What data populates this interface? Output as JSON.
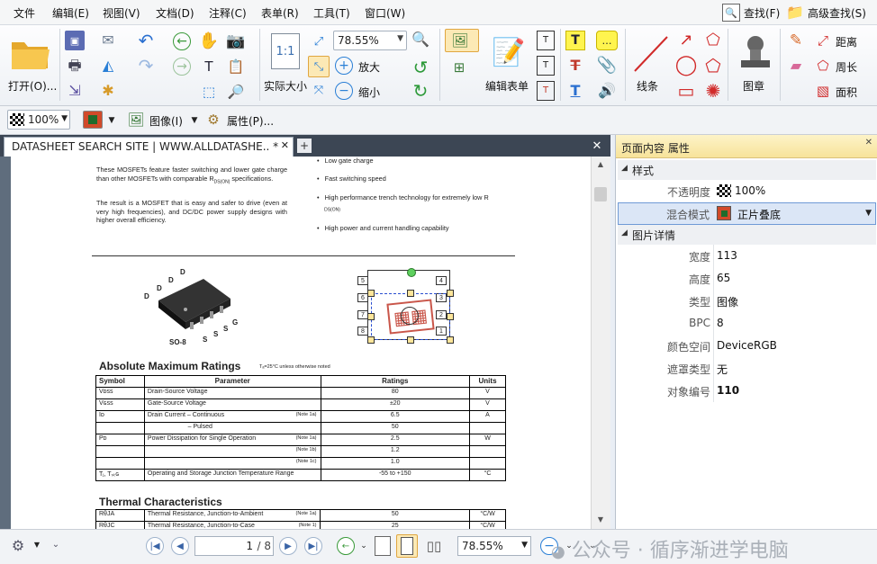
{
  "menu": {
    "items": [
      "文件",
      "编辑(E)",
      "视图(V)",
      "文档(D)",
      "注释(C)",
      "表单(R)",
      "工具(T)",
      "窗口(W)"
    ],
    "find": "查找(F)",
    "advfind": "高级查找(S)"
  },
  "ribbon": {
    "open_label": "打开(O)...",
    "actual_size_label": "实际大小",
    "zoom_value": "78.55%",
    "zoom_in_label": "放大",
    "zoom_out_label": "缩小",
    "edit_form_label": "编辑表单",
    "lines_label": "线条",
    "stamp_label": "图章",
    "distance_label": "距离",
    "perimeter_label": "周长",
    "area_label": "面积"
  },
  "proptool": {
    "opacity": "100%",
    "image_label": "图像(I)",
    "props_label": "属性(P)..."
  },
  "tab": {
    "title": "DATASHEET SEARCH SITE | WWW.ALLDATASHE.. *"
  },
  "doc": {
    "intro1": "These MOSFETs feature faster switching and lower gate charge than other MOSFETs with comparable R",
    "intro1_sub": "DS(ON)",
    "intro1_end": " specifications.",
    "intro2": "The result is a MOSFET that is easy and safer to drive (even at very high frequencies), and DC/DC power supply designs with higher overall efficiency.",
    "features": [
      "Low gate charge",
      "Fast switching speed",
      "High performance trench technology for extremely low R",
      "High power and current handling capability"
    ],
    "feature_sub": "DS(ON)",
    "pkg_d": "D",
    "pkg_s": "S",
    "pkg_g": "G",
    "pkg_name": "SO-8",
    "pins": [
      "5",
      "6",
      "7",
      "8",
      "4",
      "3",
      "2",
      "1"
    ],
    "abs_title": "Absolute Maximum Ratings",
    "abs_note": "Tₐ=25°C unless otherwise noted",
    "headers": [
      "Symbol",
      "Parameter",
      "Ratings",
      "Units"
    ],
    "rows": [
      {
        "sym": "Vᴅss",
        "param": "Drain-Source Voltage",
        "note": "",
        "rating": "80",
        "unit": "V"
      },
      {
        "sym": "Vɢss",
        "param": "Gate-Source Voltage",
        "note": "",
        "rating": "±20",
        "unit": "V"
      },
      {
        "sym": "Iᴅ",
        "param": "Drain Current    – Continuous",
        "note": "(Note 1a)",
        "rating": "6.5",
        "unit": "A"
      },
      {
        "sym": "",
        "param": "                       – Pulsed",
        "note": "",
        "rating": "50",
        "unit": ""
      },
      {
        "sym": "Pᴅ",
        "param": "Power Dissipation for Single Operation",
        "note": "(Note 1a)",
        "rating": "2.5",
        "unit": "W"
      },
      {
        "sym": "",
        "param": "",
        "note": "(Note 1b)",
        "rating": "1.2",
        "unit": ""
      },
      {
        "sym": "",
        "param": "",
        "note": "(Note 1c)",
        "rating": "1.0",
        "unit": ""
      },
      {
        "sym": "Tⱼ, Tₛₜɢ",
        "param": "Operating and Storage Junction Temperature Range",
        "note": "",
        "rating": "-55 to +150",
        "unit": "°C"
      }
    ],
    "thermal_title": "Thermal Characteristics",
    "trows": [
      {
        "sym": "RθJA",
        "param": "Thermal Resistance, Junction-to-Ambient",
        "note": "(Note 1a)",
        "rating": "50",
        "unit": "°C/W"
      },
      {
        "sym": "RθJC",
        "param": "Thermal Resistance, Junction-to-Case",
        "note": "(Note 1)",
        "rating": "25",
        "unit": "°C/W"
      }
    ]
  },
  "panel": {
    "title": "页面内容 属性",
    "section_style": "样式",
    "opacity_label": "不透明度",
    "opacity_value": "100%",
    "blend_label": "混合模式",
    "blend_value": "正片叠底",
    "section_image": "图片详情",
    "rows": [
      {
        "label": "宽度",
        "value": "113"
      },
      {
        "label": "高度",
        "value": "65"
      },
      {
        "label": "类型",
        "value": "图像"
      },
      {
        "label": "BPC",
        "value": "8"
      },
      {
        "label": "颜色空间",
        "value": "DeviceRGB"
      },
      {
        "label": "遮罩类型",
        "value": "无"
      },
      {
        "label": "对象编号",
        "value": "110"
      }
    ]
  },
  "status": {
    "page_value": "1",
    "page_total": "/ 8",
    "zoom_value": "78.55%"
  },
  "watermark": "公众号 · 循序渐进学电脑"
}
